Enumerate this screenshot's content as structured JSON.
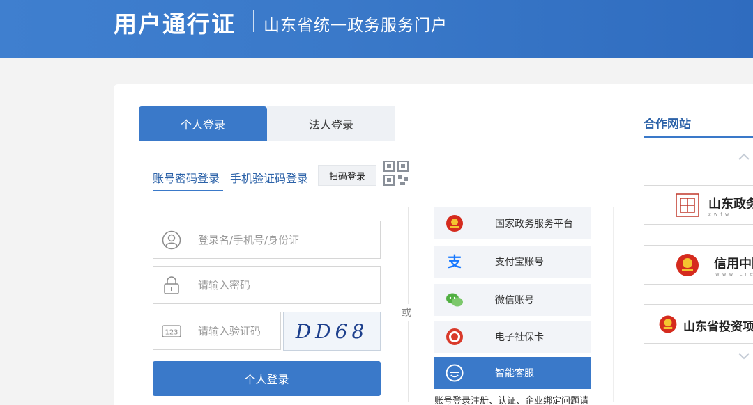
{
  "header": {
    "brand": "用户通行证",
    "portal": "山东省统一政务服务门户"
  },
  "tabs": {
    "personal": "个人登录",
    "legal": "法人登录"
  },
  "login_methods": {
    "password": "账号密码登录",
    "sms": "手机验证码登录",
    "qr": "扫码登录"
  },
  "form": {
    "username_placeholder": "登录名/手机号/身份证",
    "password_placeholder": "请输入密码",
    "captcha_placeholder": "请输入验证码",
    "captcha_text": "DD68",
    "submit": "个人登录"
  },
  "or_text": "或",
  "alt_logins": [
    {
      "label": "国家政务服务平台",
      "icon": "national-emblem-icon"
    },
    {
      "label": "支付宝账号",
      "icon": "alipay-icon"
    },
    {
      "label": "微信账号",
      "icon": "wechat-icon"
    },
    {
      "label": "电子社保卡",
      "icon": "social-security-icon"
    },
    {
      "label": "智能客服",
      "icon": "chat-bot-icon"
    }
  ],
  "note": "账号登录注册、认证、企业绑定问题请",
  "partners": {
    "title": "合作网站",
    "items": [
      {
        "name": "山东政务",
        "sub": "zwfw"
      },
      {
        "name": "信用中国",
        "sub": "www.cre"
      },
      {
        "name": "山东省投资项"
      }
    ]
  },
  "colors": {
    "primary": "#3a79c9",
    "header": "#3f7fcf",
    "link": "#2c62a8"
  }
}
